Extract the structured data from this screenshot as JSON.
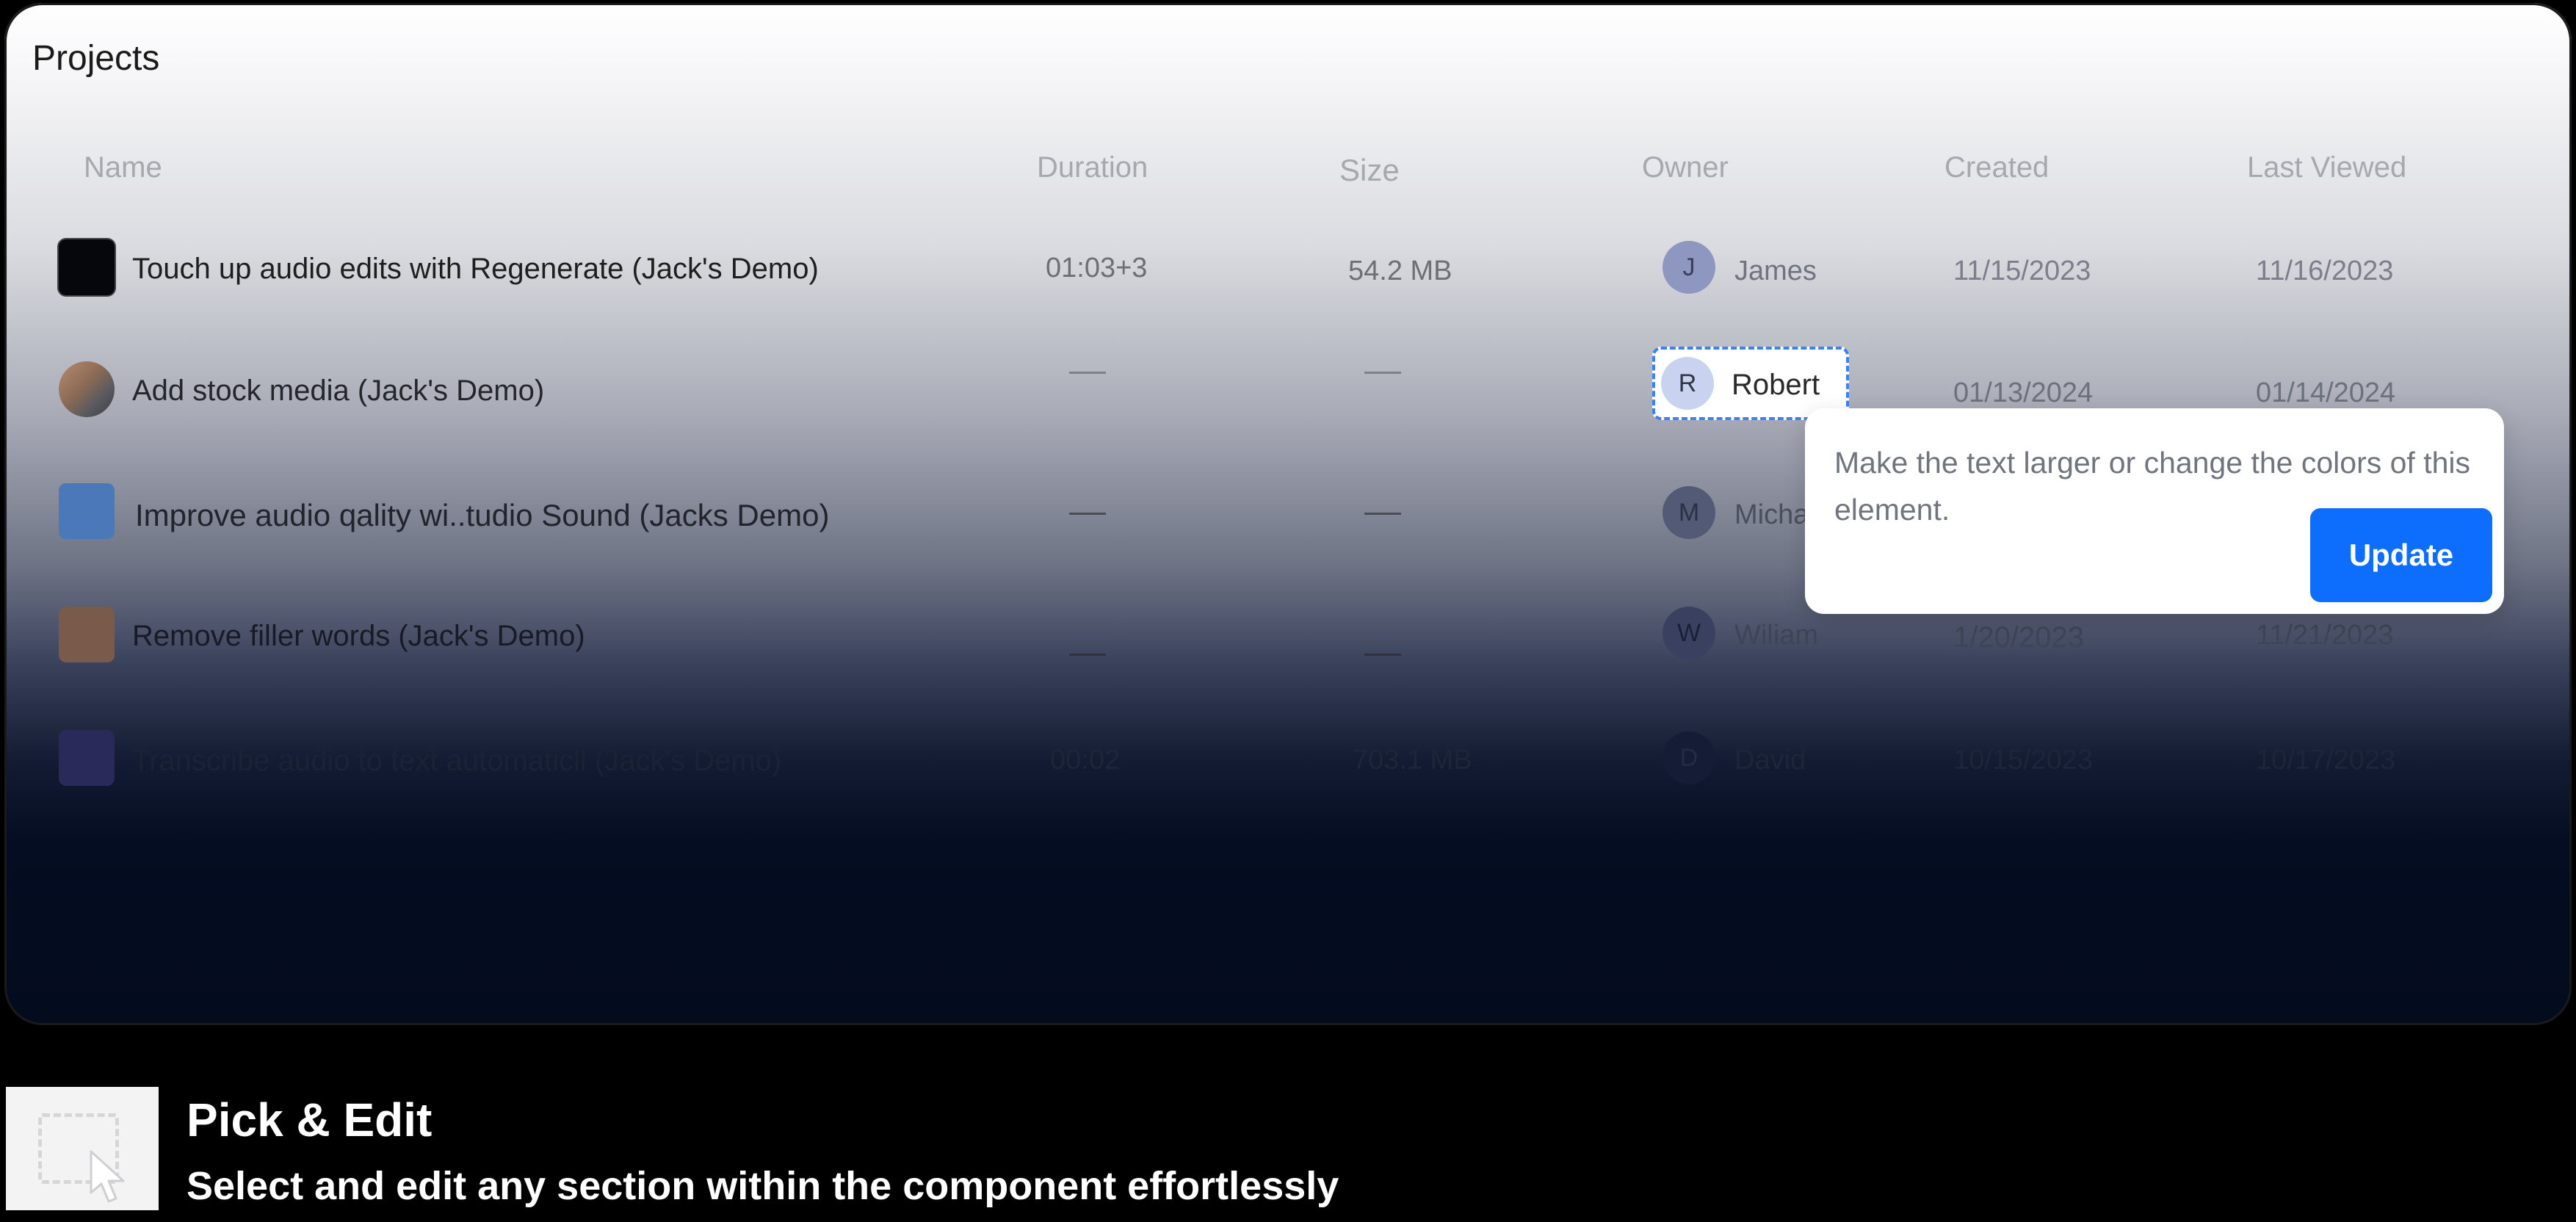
{
  "card": {
    "title": "Projects"
  },
  "table": {
    "headers": {
      "name": "Name",
      "duration": "Duration",
      "size": "Size",
      "owner": "Owner",
      "created": "Created",
      "last_viewed": "Last Viewed"
    },
    "rows": [
      {
        "name": "Touch up audio edits with Regenerate (Jack's Demo)",
        "duration": "01:03+3",
        "size": "54.2 MB",
        "owner_initial": "J",
        "owner": "James",
        "created": "11/15/2023",
        "last_viewed": "11/16/2023",
        "thumb_icon": "black-video-thumbnail"
      },
      {
        "name": "Add stock media (Jack's Demo)",
        "duration": "—",
        "size": "—",
        "owner_initial": "R",
        "owner": "Robert",
        "created": "01/13/2024",
        "last_viewed": "01/14/2024",
        "thumb_icon": "photo-thumbnail"
      },
      {
        "name": "Improve audio qality wi..tudio Sound (Jacks Demo)",
        "duration": "—",
        "size": "—",
        "owner_initial": "M",
        "owner": "Micha",
        "created": "",
        "last_viewed": "",
        "thumb_icon": "blue-app-thumbnail"
      },
      {
        "name": "Remove filler words (Jack's Demo)",
        "duration": "—",
        "size": "—",
        "owner_initial": "W",
        "owner": "Wiliam",
        "created": "1/20/2023",
        "last_viewed": "11/21/2023",
        "thumb_icon": "orange-doc-thumbnail"
      },
      {
        "name": "Transcribe audio to text automaticll (Jack's Demo)",
        "duration": "00:02",
        "size": "703.1 MB",
        "owner_initial": "D",
        "owner": "David",
        "created": "10/15/2023",
        "last_viewed": "10/17/2023",
        "thumb_icon": "purple-thumbnail"
      }
    ]
  },
  "popover": {
    "text": "Make the text larger or change the colors of this element.",
    "button": "Update"
  },
  "feature": {
    "title": "Pick & Edit",
    "subtitle": "Select and edit any section within the component effortlessly",
    "icon": "pick-select-icon"
  },
  "colors": {
    "accent": "#0d6efd",
    "selection_border": "#3b82f6"
  }
}
